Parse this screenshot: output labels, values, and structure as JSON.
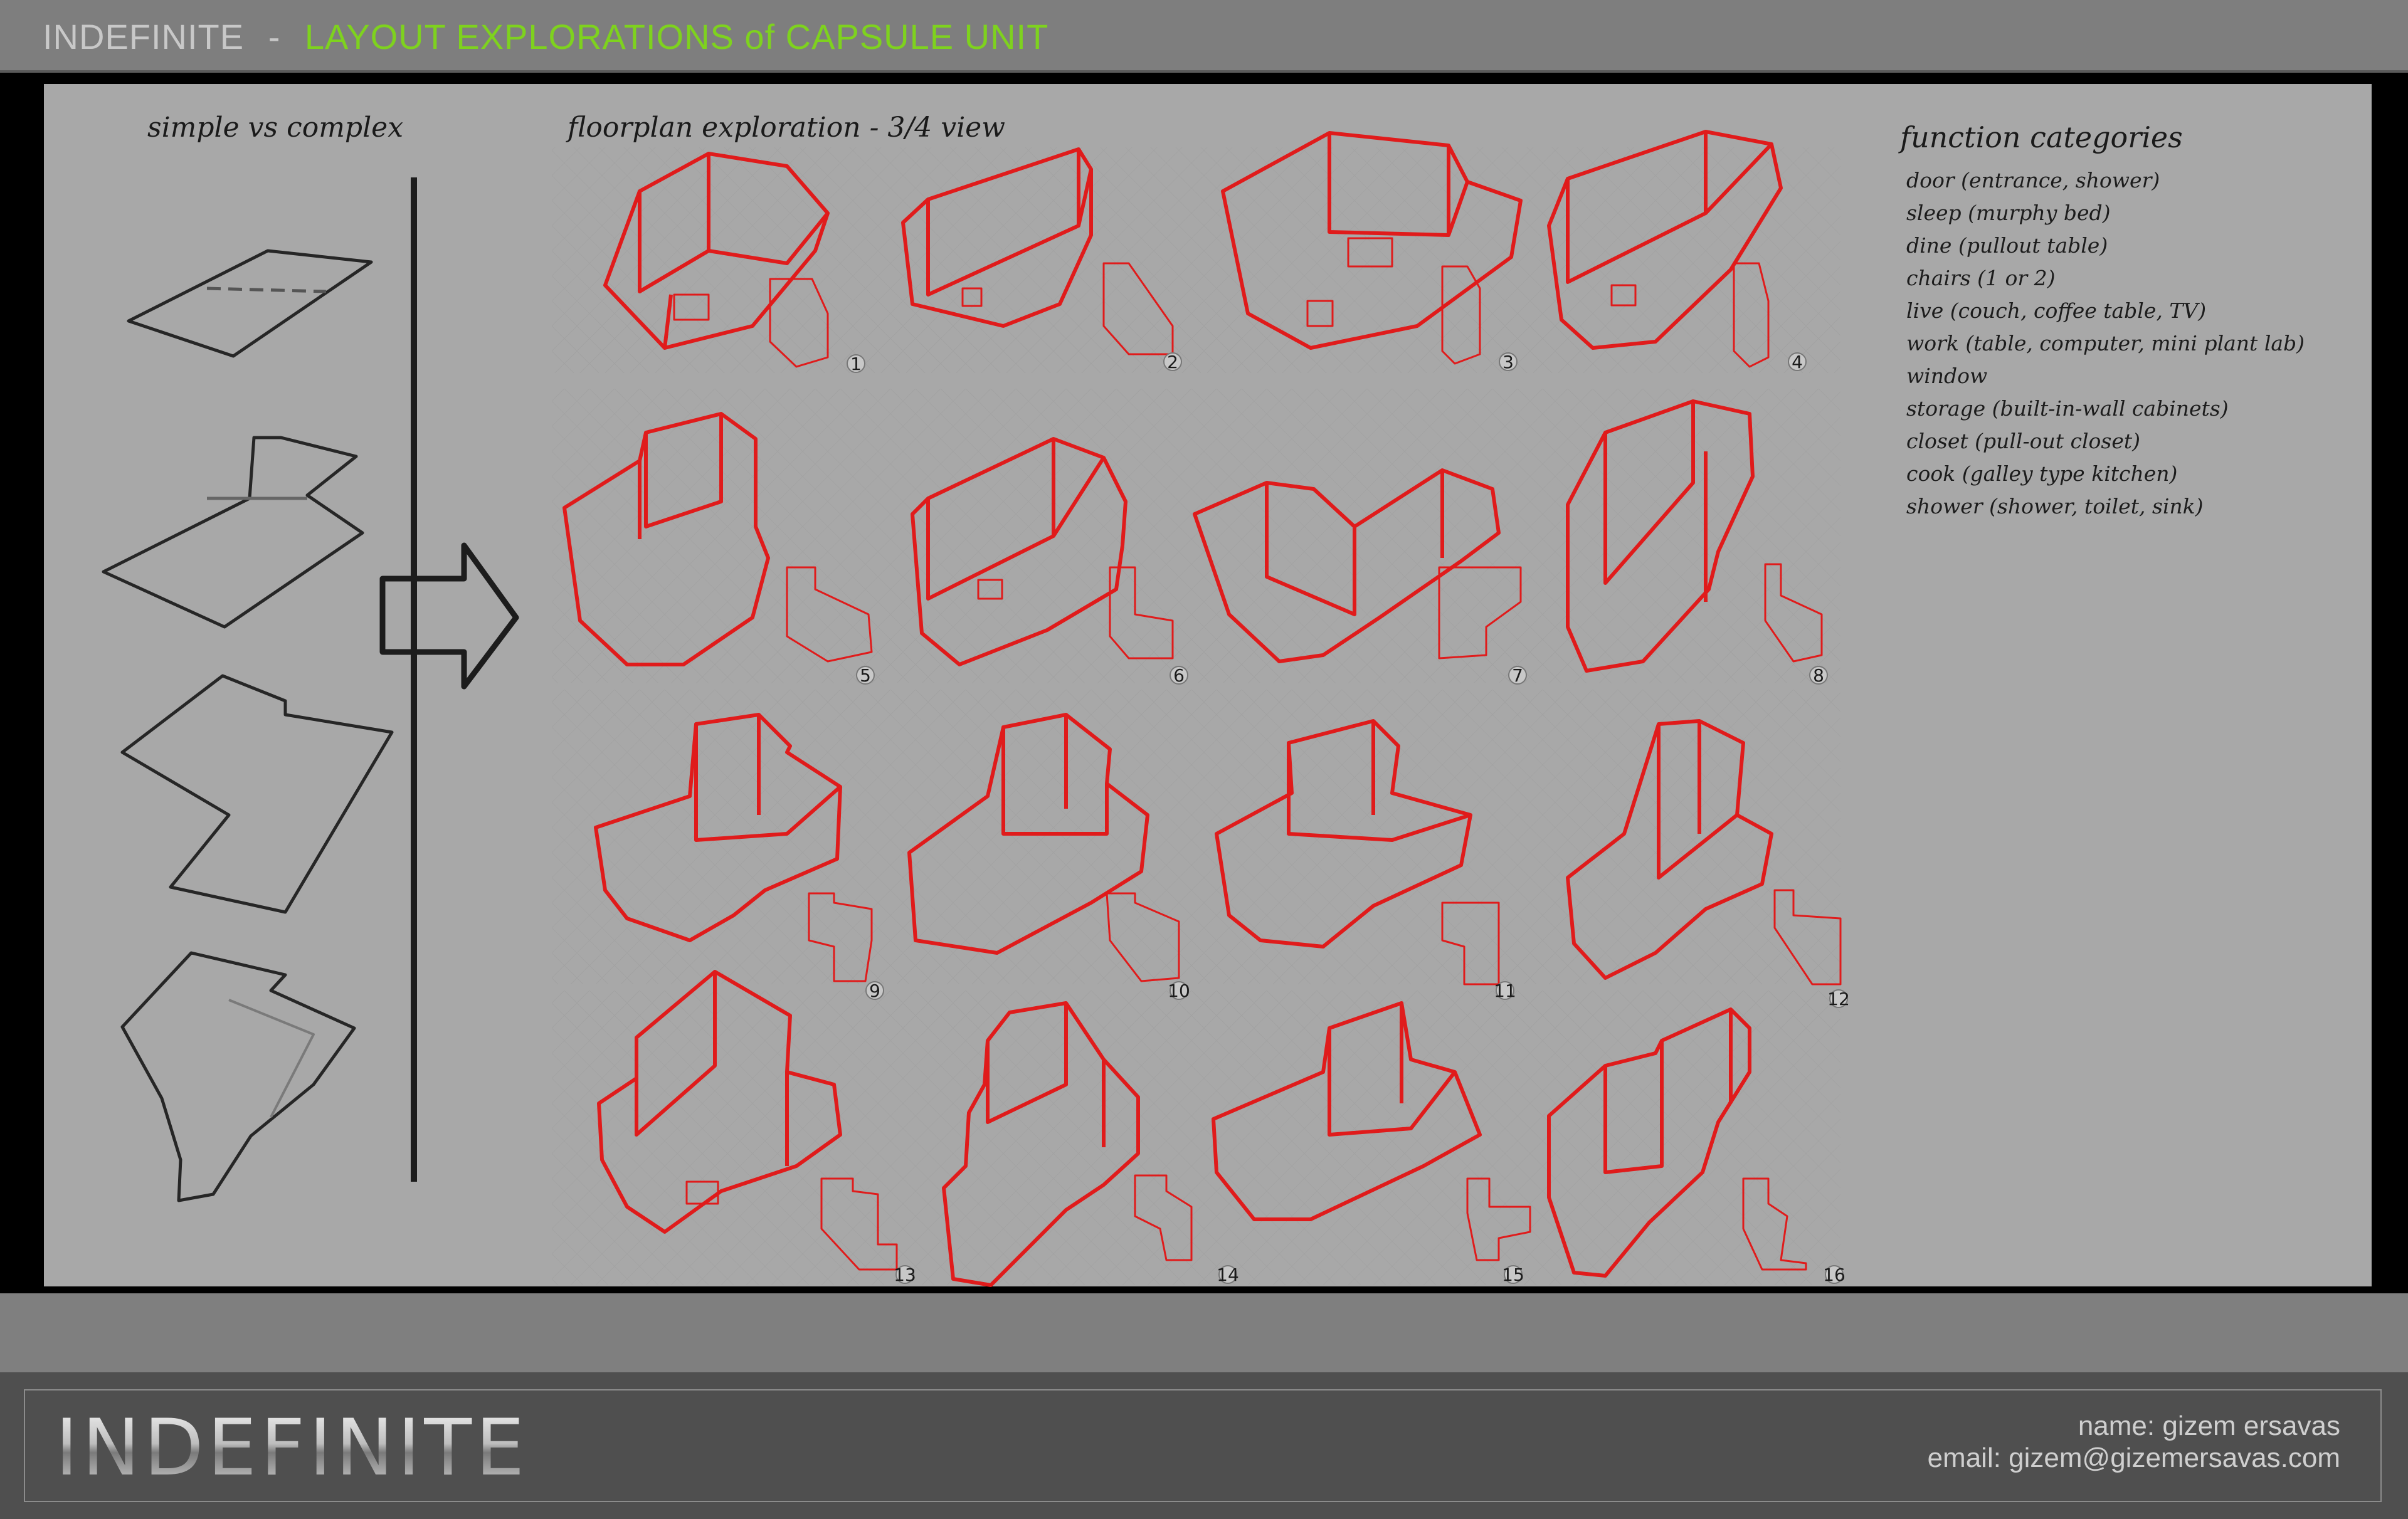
{
  "header": {
    "brand": "INDEFINITE",
    "separator": "-",
    "subtitle": "LAYOUT EXPLORATIONS of CAPSULE UNIT"
  },
  "colors": {
    "accent_green": "#7ed21e",
    "drawing_red": "#e01b1b",
    "panel_gray": "#a8a8a8"
  },
  "left_section": {
    "title": "simple vs complex"
  },
  "middle_section": {
    "title": "floorplan exploration - 3/4 view",
    "tiles": [
      "1",
      "2",
      "3",
      "4",
      "5",
      "6",
      "7",
      "8",
      "9",
      "10",
      "11",
      "12",
      "13",
      "14",
      "15",
      "16"
    ]
  },
  "right_section": {
    "title": "function categories",
    "items": [
      "door (entrance, shower)",
      "sleep (murphy bed)",
      "dine (pullout table)",
      "chairs (1 or 2)",
      "live (couch, coffee table, TV)",
      "work (table, computer, mini plant lab)",
      "window",
      "storage (built-in-wall cabinets)",
      "closet (pull-out closet)",
      "cook (galley type kitchen)",
      "shower (shower, toilet, sink)"
    ]
  },
  "footer": {
    "logo": "INDEFINITE",
    "name": "name:  gizem ersavas",
    "email": "email:  gizem@gizemersavas.com"
  }
}
